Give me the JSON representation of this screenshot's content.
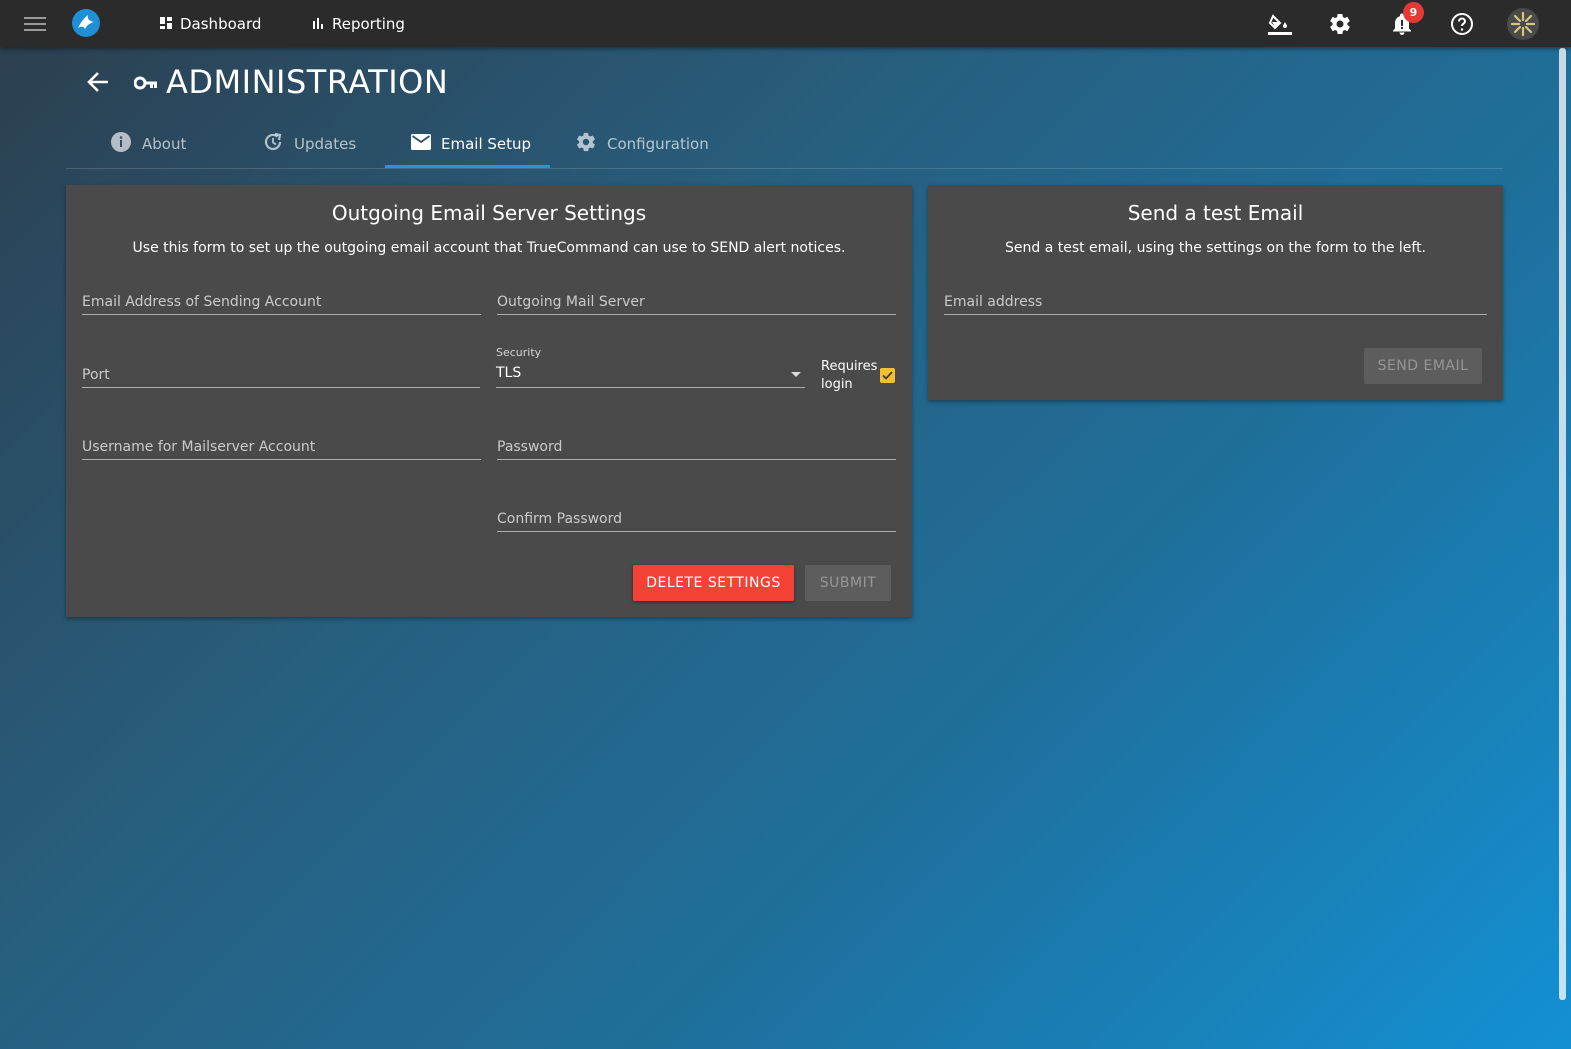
{
  "topbar": {
    "menu_icon": "hamburger-menu-icon",
    "logo_icon": "truecommand-logo-icon",
    "nav": [
      {
        "label": "Dashboard",
        "icon": "dashboard-grid-icon"
      },
      {
        "label": "Reporting",
        "icon": "bar-chart-icon"
      }
    ],
    "right_icons": [
      "theme-paint-bucket-icon",
      "settings-gear-icon",
      "notifications-bell-icon",
      "help-circle-icon",
      "user-avatar-icon"
    ],
    "notification_count": "9"
  },
  "header": {
    "back_icon": "arrow-back-icon",
    "title_icon": "key-icon",
    "title": "ADMINISTRATION"
  },
  "tabs": [
    {
      "label": "About",
      "icon": "info-icon",
      "active": false
    },
    {
      "label": "Updates",
      "icon": "update-refresh-icon",
      "active": false
    },
    {
      "label": "Email Setup",
      "icon": "email-icon",
      "active": true
    },
    {
      "label": "Configuration",
      "icon": "gear-icon",
      "active": false
    }
  ],
  "outgoing": {
    "title": "Outgoing Email Server Settings",
    "description": "Use this form to set up the outgoing email account that TrueCommand can use to SEND alert notices.",
    "email_placeholder": "Email Address of Sending Account",
    "server_placeholder": "Outgoing Mail Server",
    "port_placeholder": "Port",
    "security_label": "Security",
    "security_value": "TLS",
    "requires_login_label": "Requires login",
    "requires_login_checked": true,
    "username_placeholder": "Username for Mailserver Account",
    "password_placeholder": "Password",
    "confirm_password_placeholder": "Confirm Password",
    "delete_label": "DELETE SETTINGS",
    "submit_label": "SUBMIT"
  },
  "test_email": {
    "title": "Send a test Email",
    "description": "Send a test email, using the settings on the form to the left.",
    "email_placeholder": "Email address",
    "send_label": "SEND EMAIL"
  },
  "colors": {
    "topbar": "#2b2b2b",
    "card": "#4a4a4a",
    "accent": "#1e9bd7",
    "delete": "#f44336",
    "checkbox": "#f2c12e",
    "badge": "#e53935"
  }
}
